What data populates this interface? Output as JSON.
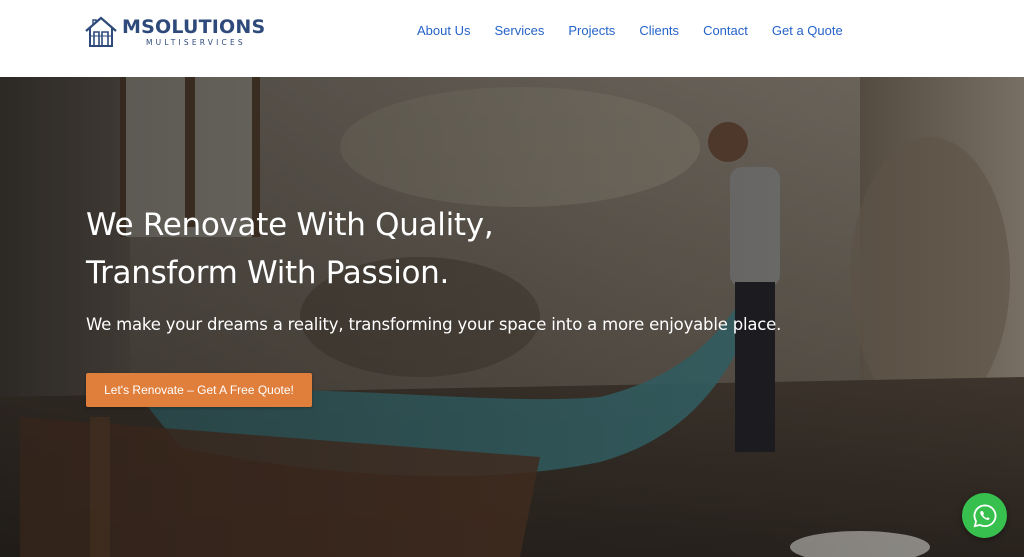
{
  "brand": {
    "name": "MSOLUTIONS",
    "tagline": "MULTISERVICES"
  },
  "nav": {
    "items": [
      {
        "label": "About Us"
      },
      {
        "label": "Services"
      },
      {
        "label": "Projects"
      },
      {
        "label": "Clients"
      },
      {
        "label": "Contact"
      },
      {
        "label": "Get a Quote"
      }
    ]
  },
  "hero": {
    "title_line1": "We Renovate With Quality,",
    "title_line2": "Transform With Passion.",
    "subtitle": "We make your dreams a reality, transforming your space into a more enjoyable place.",
    "cta_label": "Let's Renovate – Get A Free Quote!"
  },
  "colors": {
    "brand": "#2e4a7a",
    "nav_link": "#2563c9",
    "cta": "#e07e3c",
    "whatsapp": "#38c04f"
  },
  "icons": {
    "whatsapp": "whatsapp-icon",
    "logo": "house-logo-icon"
  }
}
